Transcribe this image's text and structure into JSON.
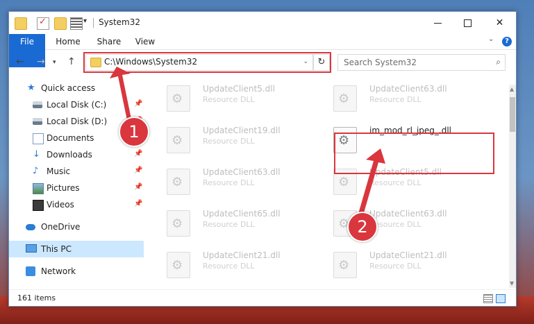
{
  "window": {
    "title": "System32",
    "quick_access_toolbar_dropdown": "▾",
    "controls": {
      "minimize": "minimize-icon",
      "maximize": "maximize-icon",
      "close": "✕"
    }
  },
  "ribbon": {
    "tabs": [
      "File",
      "Home",
      "Share",
      "View"
    ],
    "collapse": "⌄",
    "help": "?"
  },
  "nav": {
    "back": "←",
    "forward": "→",
    "recent": "▾",
    "up": "↑",
    "address": "C:\\Windows\\System32",
    "address_dropdown": "⌄",
    "refresh": "↻",
    "search_placeholder": "Search System32",
    "search_icon": "⌕"
  },
  "sidebar": {
    "items": [
      {
        "label": "Quick access",
        "icon": "star-icon",
        "pinned": false
      },
      {
        "label": "Local Disk (C:)",
        "icon": "disk-icon",
        "pinned": true
      },
      {
        "label": "Local Disk (D:)",
        "icon": "disk-icon",
        "pinned": true
      },
      {
        "label": "Documents",
        "icon": "documents-icon",
        "pinned": true
      },
      {
        "label": "Downloads",
        "icon": "download-icon",
        "pinned": true
      },
      {
        "label": "Music",
        "icon": "music-icon",
        "pinned": true
      },
      {
        "label": "Pictures",
        "icon": "pictures-icon",
        "pinned": true
      },
      {
        "label": "Videos",
        "icon": "videos-icon",
        "pinned": true
      },
      {
        "label": "OneDrive",
        "icon": "onedrive-icon",
        "pinned": false
      },
      {
        "label": "This PC",
        "icon": "pc-icon",
        "pinned": false,
        "selected": true
      },
      {
        "label": "Network",
        "icon": "network-icon",
        "pinned": false
      }
    ],
    "pin_glyph": "📌"
  },
  "files": [
    {
      "name": "UpdateClient5.dll",
      "type": "Resource DLL"
    },
    {
      "name": "UpdateClient63.dll",
      "type": "Resource DLL"
    },
    {
      "name": "UpdateClient19.dll",
      "type": "Resource DLL"
    },
    {
      "name": "im_mod_rl_jpeg_.dll",
      "type": "",
      "active": true
    },
    {
      "name": "UpdateClient63.dll",
      "type": "Resource DLL"
    },
    {
      "name": "UpdateClient5.dll",
      "type": "Resource DLL"
    },
    {
      "name": "UpdateClient65.dll",
      "type": "Resource DLL"
    },
    {
      "name": "UpdateClient63.dll",
      "type": "Resource DLL"
    },
    {
      "name": "UpdateClient21.dll",
      "type": "Resource DLL"
    },
    {
      "name": "UpdateClient21.dll",
      "type": "Resource DLL"
    }
  ],
  "status": {
    "item_count": "161 items"
  },
  "annotations": {
    "step1": "1",
    "step2": "2",
    "highlight_color": "#d9363e"
  },
  "colors": {
    "accent": "#1a6ad3",
    "selection": "#cce8ff"
  }
}
